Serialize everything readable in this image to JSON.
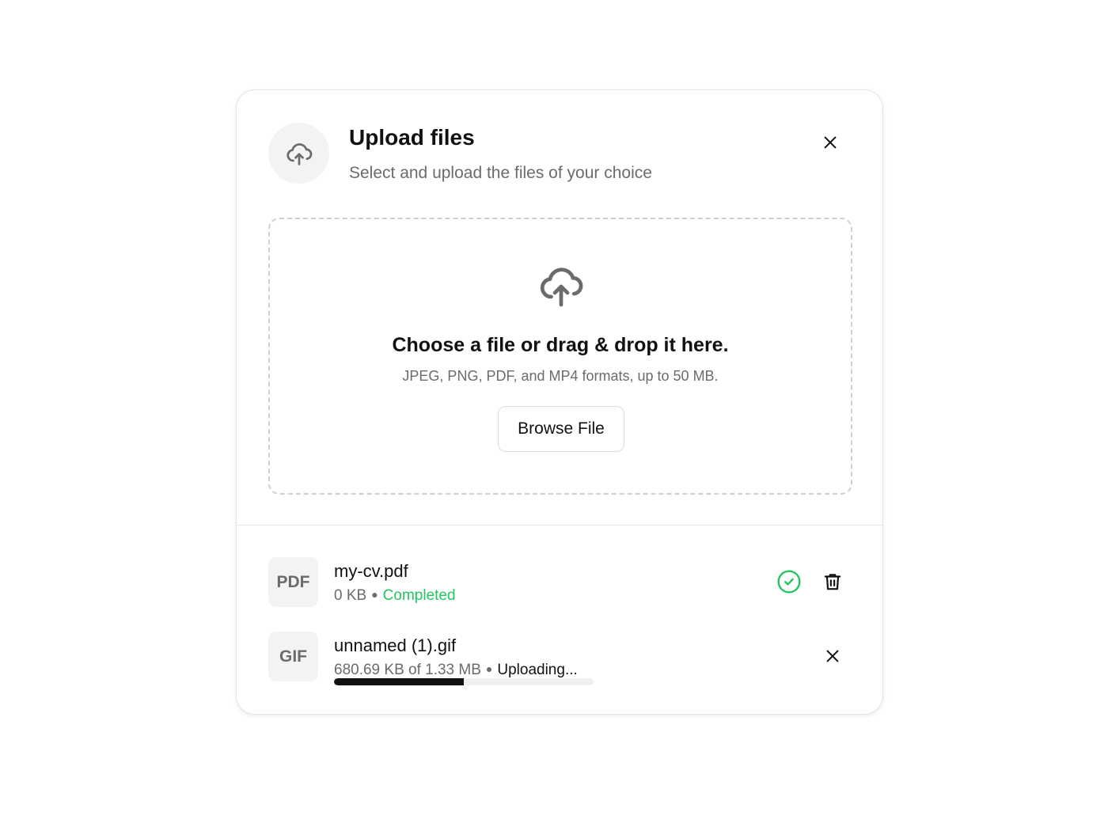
{
  "header": {
    "title": "Upload files",
    "subtitle": "Select and upload the files of your choice",
    "icon": "cloud-upload-icon",
    "close_icon": "close-icon"
  },
  "dropzone": {
    "icon": "cloud-upload-icon",
    "title": "Choose a file or drag & drop it here.",
    "subtitle": "JPEG, PNG, PDF, and MP4 formats, up to 50 MB.",
    "browse_label": "Browse File"
  },
  "files": [
    {
      "badge": "PDF",
      "name": "my-cv.pdf",
      "size": "0 KB",
      "status": "Completed",
      "status_color": "#22c55e",
      "status_icon": "check-circle-icon",
      "action_icon": "trash-icon"
    },
    {
      "badge": "GIF",
      "name": "unnamed (1).gif",
      "size": "680.69 KB of 1.33 MB",
      "status": "Uploading...",
      "progress_percent": 50,
      "action_icon": "close-icon"
    }
  ],
  "colors": {
    "accent": "#111111",
    "success": "#22c55e",
    "muted_text": "#6b6b6b",
    "icon_bg": "#f3f3f3"
  }
}
